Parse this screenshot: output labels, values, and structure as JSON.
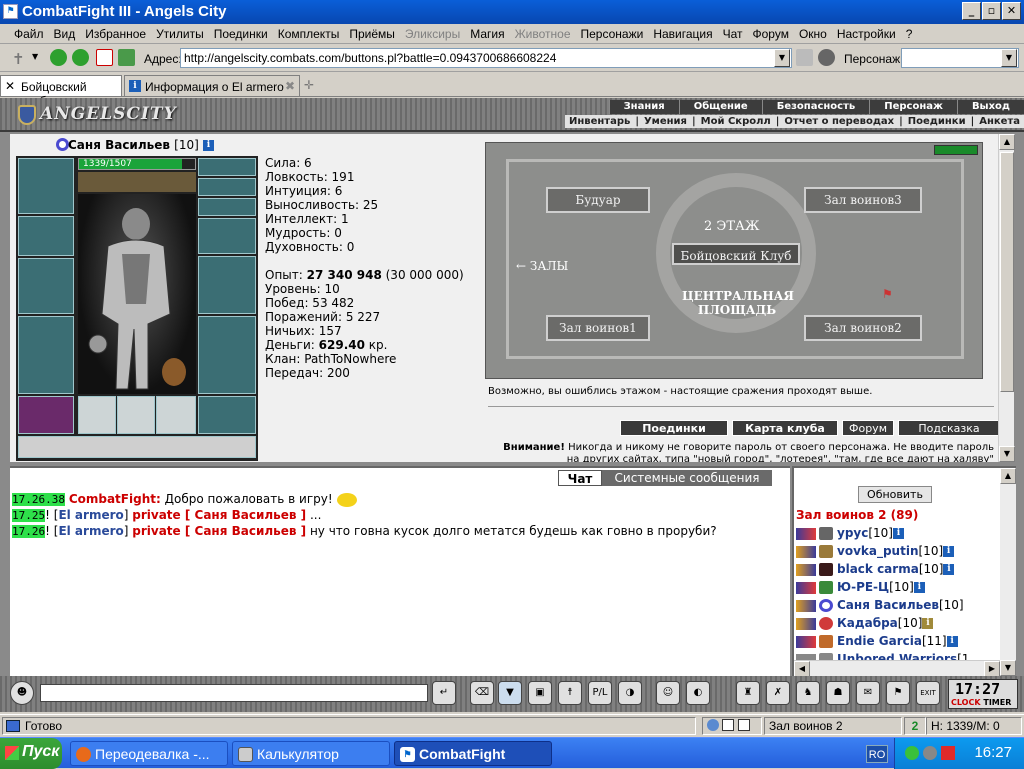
{
  "window": {
    "title": "CombatFight III - Angels City"
  },
  "menu": {
    "items": [
      {
        "label": "Файл",
        "disabled": false
      },
      {
        "label": "Вид",
        "disabled": false
      },
      {
        "label": "Избранное",
        "disabled": false
      },
      {
        "label": "Утилиты",
        "disabled": false
      },
      {
        "label": "Поединки",
        "disabled": false
      },
      {
        "label": "Комплекты",
        "disabled": false
      },
      {
        "label": "Приёмы",
        "disabled": false
      },
      {
        "label": "Эликсиры",
        "disabled": true
      },
      {
        "label": "Магия",
        "disabled": false
      },
      {
        "label": "Животное",
        "disabled": true
      },
      {
        "label": "Персонажи",
        "disabled": false
      },
      {
        "label": "Навигация",
        "disabled": false
      },
      {
        "label": "Чат",
        "disabled": false
      },
      {
        "label": "Форум",
        "disabled": false
      },
      {
        "label": "Окно",
        "disabled": false
      },
      {
        "label": "Настройки",
        "disabled": false
      },
      {
        "label": "?",
        "disabled": false
      }
    ]
  },
  "address": {
    "label": "Адрес:",
    "url": "http://angelscity.combats.com/buttons.pl?battle=0.0943700686608224",
    "persona_label": "Персонаж:"
  },
  "tabs": [
    {
      "label": "Бойцовский клуб"
    },
    {
      "label": "Информация о El armero"
    }
  ],
  "game": {
    "logo": "ANGELSCITY",
    "nav_top": [
      "Знания",
      "Общение",
      "Безопасность",
      "Персонаж",
      "Выход"
    ],
    "nav_bottom": [
      "Инвентарь",
      "Умения",
      "Мой Скролл",
      "Отчет о переводах",
      "Поединки",
      "Анкета"
    ]
  },
  "character": {
    "name": "Саня Васильев",
    "level": "[10]",
    "hp": "1339/1507",
    "hp_fraction": 0.888
  },
  "stats": {
    "strength": "Сила: 6",
    "agility": "Ловкость: 191",
    "intuition": "Интуиция: 6",
    "endurance": "Выносливость: 25",
    "intellect": "Интеллект: 1",
    "wisdom": "Мудрость: 0",
    "spirit": "Духовность: 0",
    "exp_label": "Опыт:",
    "exp_value": "27 340 948",
    "exp_next": "(30 000 000)",
    "level": "Уровень: 10",
    "wins": "Побед: 53 482",
    "losses": "Поражений: 5 227",
    "draws": "Ничьих: 157",
    "money_label": "Деньги:",
    "money_value": "629.40",
    "money_unit": "кр.",
    "clan": "Клан: PathToNowhere",
    "transfers": "Передач: 200"
  },
  "map": {
    "rooms": {
      "boudoir": "Будуар",
      "warriors3": "Зал воинов3",
      "floor2": "2 ЭТАЖ",
      "fightclub": "Бойцовский Клуб",
      "halls": "ЗАЛЫ",
      "central1": "ЦЕНТРАЛЬНАЯ",
      "central2": "ПЛОЩАДЬ",
      "warriors1": "Зал воинов1",
      "warriors2": "Зал воинов2"
    },
    "caption": "Возможно, вы ошиблись этажом - настоящие сражения проходят выше.",
    "buttons": [
      "Поединки",
      "Карта клуба",
      "Форум",
      "Подсказка"
    ],
    "warning_bold": "Внимание!",
    "warning_text": "Никогда и никому не говорите пароль от своего персонажа. Не вводите пароль на других сайтах, типа \"новый город\", \"лотерея\", \"там, где все дают на халяву\""
  },
  "chat": {
    "tabs": [
      "Чат",
      "Системные сообщения"
    ],
    "lines": [
      {
        "time": "17.26.38",
        "nick": "CombatFight:",
        "text": "Добро пожаловать в игру!"
      },
      {
        "time": "17.25",
        "from": "El armero",
        "priv": "private [ Саня Васильев ]",
        "text": "..."
      },
      {
        "time": "17.26",
        "from": "El armero",
        "priv": "private [ Саня Васильев ]",
        "text": "ну что говна кусок долго метатся будешь как говно в проруби?"
      }
    ]
  },
  "users": {
    "refresh": "Обновить",
    "room": "Зал воинов 2 (89)",
    "list": [
      {
        "name": "урус",
        "level": "[10]"
      },
      {
        "name": "vovka_putin",
        "level": "[10]"
      },
      {
        "name": "black carma",
        "level": "[10]"
      },
      {
        "name": "Ю-РЕ-Ц",
        "level": "[10]"
      },
      {
        "name": "Саня Васильев",
        "level": "[10]"
      },
      {
        "name": "Кадабра",
        "level": "[10]"
      },
      {
        "name": "Endie Garcia",
        "level": "[11]"
      },
      {
        "name": "Unbored Warriors",
        "level": "[1"
      }
    ]
  },
  "clock": {
    "time": "17:27",
    "labels": [
      "CLOCK",
      "TIMER"
    ]
  },
  "status": {
    "ready": "Готово",
    "room": "Зал воинов 2",
    "hp": "Н: 1339/М: 0"
  },
  "taskbar": {
    "start": "Пуск",
    "tasks": [
      "Переодевалка -...",
      "Калькулятор",
      "CombatFight"
    ],
    "lang": "RO",
    "time": "16:27"
  },
  "colors": {
    "titlebar": "#0a5fd8",
    "taskbar": "#245edb",
    "hp": "#1aa43a",
    "nick": "#cc0000",
    "user": "#1c3c8c",
    "timestamp": "#2ee04a"
  }
}
